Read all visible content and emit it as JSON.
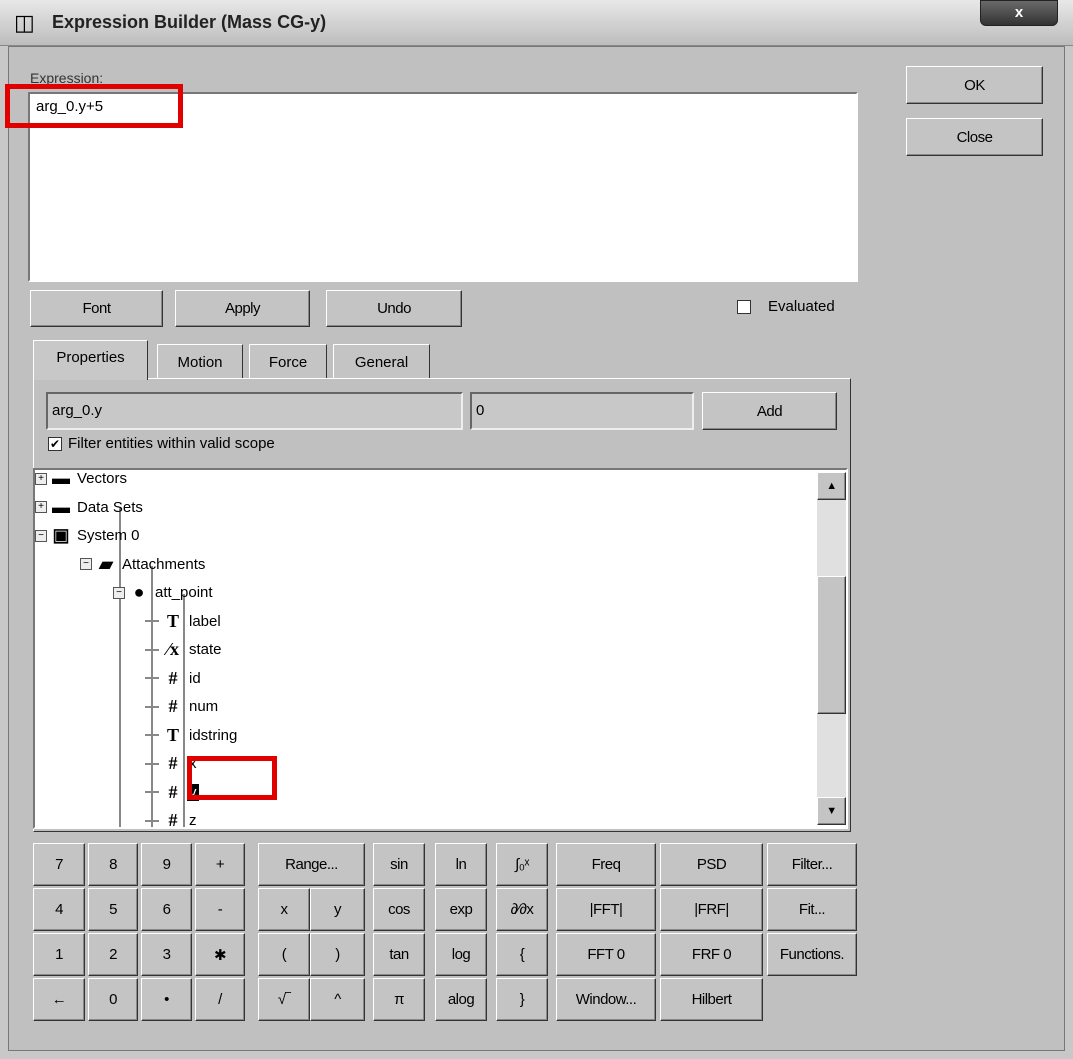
{
  "window": {
    "title": "Expression Builder (Mass CG-y)",
    "close_label": "x"
  },
  "expression": {
    "label": "Expression:",
    "value": "arg_0.y+5"
  },
  "buttons": {
    "ok": "OK",
    "close": "Close",
    "font": "Font",
    "apply": "Apply",
    "undo": "Undo",
    "add": "Add"
  },
  "evaluated": {
    "label": "Evaluated",
    "checked": false
  },
  "tabs": [
    {
      "label": "Properties",
      "active": true
    },
    {
      "label": "Motion"
    },
    {
      "label": "Force"
    },
    {
      "label": "General"
    }
  ],
  "selection": {
    "path": "arg_0.y",
    "value": "0"
  },
  "filter": {
    "label": "Filter entities within valid scope",
    "checked": true,
    "mark": "✔"
  },
  "tree": [
    {
      "label": "Vectors",
      "icon": "folder-icon",
      "glyph": "▬"
    },
    {
      "label": "Data Sets",
      "icon": "folder-icon",
      "glyph": "▬"
    },
    {
      "label": "System 0",
      "icon": "system-icon",
      "glyph": "▣"
    },
    {
      "label": "Attachments",
      "icon": "open-folder-icon",
      "glyph": "▰"
    },
    {
      "label": "att_point",
      "icon": "sphere-icon",
      "glyph": "●"
    },
    {
      "label": "label",
      "icon": "text-icon",
      "glyph": "T"
    },
    {
      "label": "state",
      "icon": "boolean-icon",
      "glyph": "⁄x"
    },
    {
      "label": "id",
      "icon": "number-icon",
      "glyph": "#"
    },
    {
      "label": "num",
      "icon": "number-icon",
      "glyph": "#"
    },
    {
      "label": "idstring",
      "icon": "text-icon",
      "glyph": "T"
    },
    {
      "label": "x",
      "icon": "number-icon",
      "glyph": "#"
    },
    {
      "label": "y",
      "icon": "number-icon",
      "glyph": "#",
      "selected": true
    },
    {
      "label": "z",
      "icon": "number-icon",
      "glyph": "#"
    }
  ],
  "keypad": [
    [
      "7",
      "8",
      "9",
      "+",
      "Range...",
      "sin",
      "ln",
      "∫₀ˣ",
      "Freq",
      "PSD",
      "Filter..."
    ],
    [
      "4",
      "5",
      "6",
      "-",
      "x",
      "y",
      "cos",
      "exp",
      "∂⁄∂x",
      "|FFT|",
      "|FRF|",
      "Fit..."
    ],
    [
      "1",
      "2",
      "3",
      "✱",
      "(",
      ")",
      "tan",
      "log",
      "{",
      "FFT 0",
      "FRF 0",
      "Functions."
    ],
    [
      "←",
      "0",
      "•",
      "/",
      "√‾",
      "^",
      "π",
      "alog",
      "}",
      "Window...",
      "Hilbert"
    ]
  ],
  "colors": {
    "highlight": "#e00000"
  }
}
